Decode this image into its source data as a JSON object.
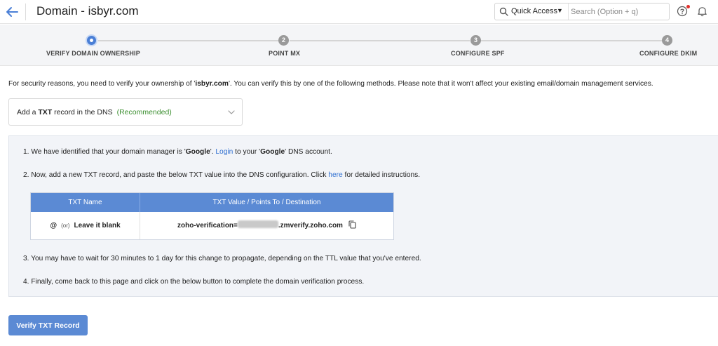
{
  "header": {
    "title": "Domain - isbyr.com",
    "back_icon": "arrow-left-icon",
    "quick_access_label": "Quick Access",
    "search_placeholder": "Search (Option + q)",
    "help_icon": "question-circle-icon",
    "bell_icon": "bell-icon",
    "accent": "#4a7fd6"
  },
  "stepper": {
    "steps": [
      {
        "number": "1",
        "label": "VERIFY DOMAIN OWNERSHIP",
        "active": true
      },
      {
        "number": "2",
        "label": "POINT MX",
        "active": false
      },
      {
        "number": "3",
        "label": "CONFIGURE SPF",
        "active": false
      },
      {
        "number": "4",
        "label": "CONFIGURE DKIM",
        "active": false
      }
    ]
  },
  "intro": {
    "before": "For security reasons, you need to verify your ownership of '",
    "domain": "isbyr.com",
    "after": "'. You can verify this by one of the following methods. Please note that it won't affect your existing email/domain management services."
  },
  "method_select": {
    "prefix": "Add a ",
    "record_type": "TXT",
    "suffix": " record in the DNS",
    "recommended": "(Recommended)"
  },
  "instructions": {
    "step1": {
      "before": "1. We have identified that your domain manager is '",
      "manager": "Google",
      "middle": "'. ",
      "login_link": "Login",
      "after1": " to your '",
      "manager2": "Google",
      "after2": "' DNS account."
    },
    "step2": {
      "before": "2. Now, add a new TXT record, and paste the below TXT value into the DNS configuration. Click ",
      "link": "here",
      "after": " for detailed instructions."
    },
    "table": {
      "col1_header": "TXT Name",
      "col2_header": "TXT Value / Points To / Destination",
      "name_at": "@",
      "name_or": "(or)",
      "name_blank": "Leave it blank",
      "value_prefix": "zoho-verification=",
      "value_suffix": ".zmverify.zoho.com"
    },
    "step3": "3. You may have to wait for 30 minutes to 1 day for this change to propagate, depending on the TTL value that you've entered.",
    "step4": "4. Finally, come back to this page and click on the below button to complete the domain verification process."
  },
  "verify_button": "Verify TXT Record"
}
